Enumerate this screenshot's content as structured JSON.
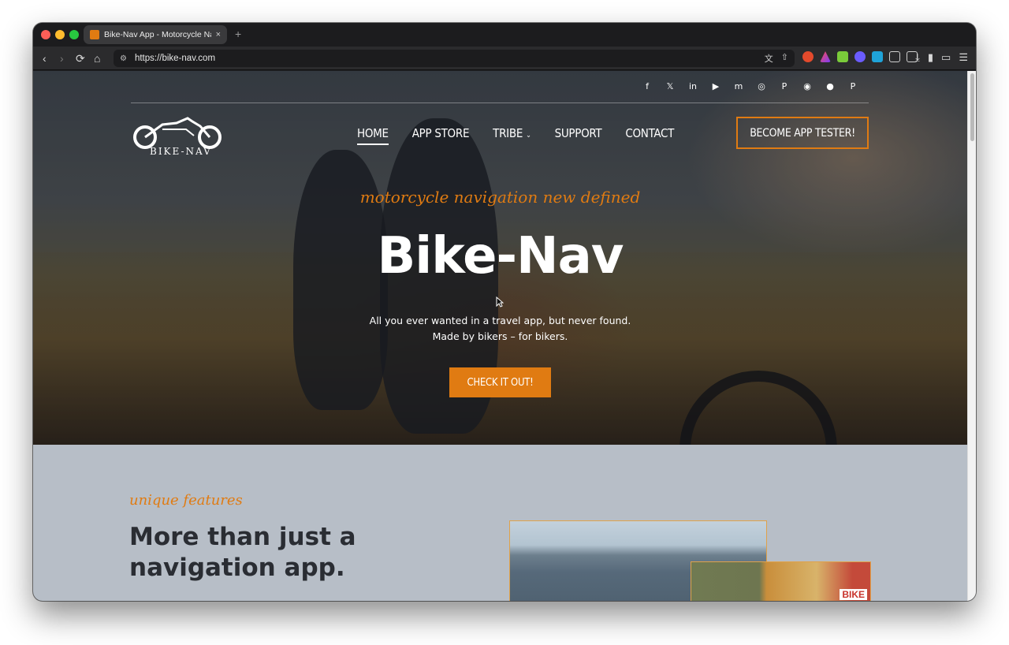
{
  "browser": {
    "tab_title": "Bike-Nav App - Motorcycle Na",
    "tab_close": "×",
    "new_tab": "+",
    "url": "https://bike-nav.com",
    "colors": {
      "chrome": "#1c1c1e",
      "toolbar": "#2b2b2d"
    }
  },
  "site": {
    "social": [
      "facebook-icon",
      "x-icon",
      "linkedin-icon",
      "youtube-icon",
      "mastodon-icon",
      "instagram-icon",
      "pinterest-icon",
      "discord-icon",
      "threads-icon",
      "paypal-icon"
    ],
    "logo_text": "BIKE-NAV",
    "nav": {
      "home": "HOME",
      "app_store": "APP STORE",
      "tribe": "TRIBE",
      "support": "SUPPORT",
      "contact": "CONTACT"
    },
    "tester_button": "BECOME APP TESTER!",
    "hero": {
      "tagline": "motorcycle navigation new defined",
      "title": "Bike-Nav",
      "subtitle_line1": "All you ever wanted in a travel app, but never found.",
      "subtitle_line2": "Made by bikers – for bikers.",
      "cta": "CHECK IT OUT!"
    },
    "features": {
      "kicker": "unique features",
      "title": "More than just a navigation app.",
      "sign_text": "BIKE"
    },
    "colors": {
      "accent": "#e07b12",
      "section_bg": "#b7bec7",
      "heading": "#2a2d33"
    }
  }
}
